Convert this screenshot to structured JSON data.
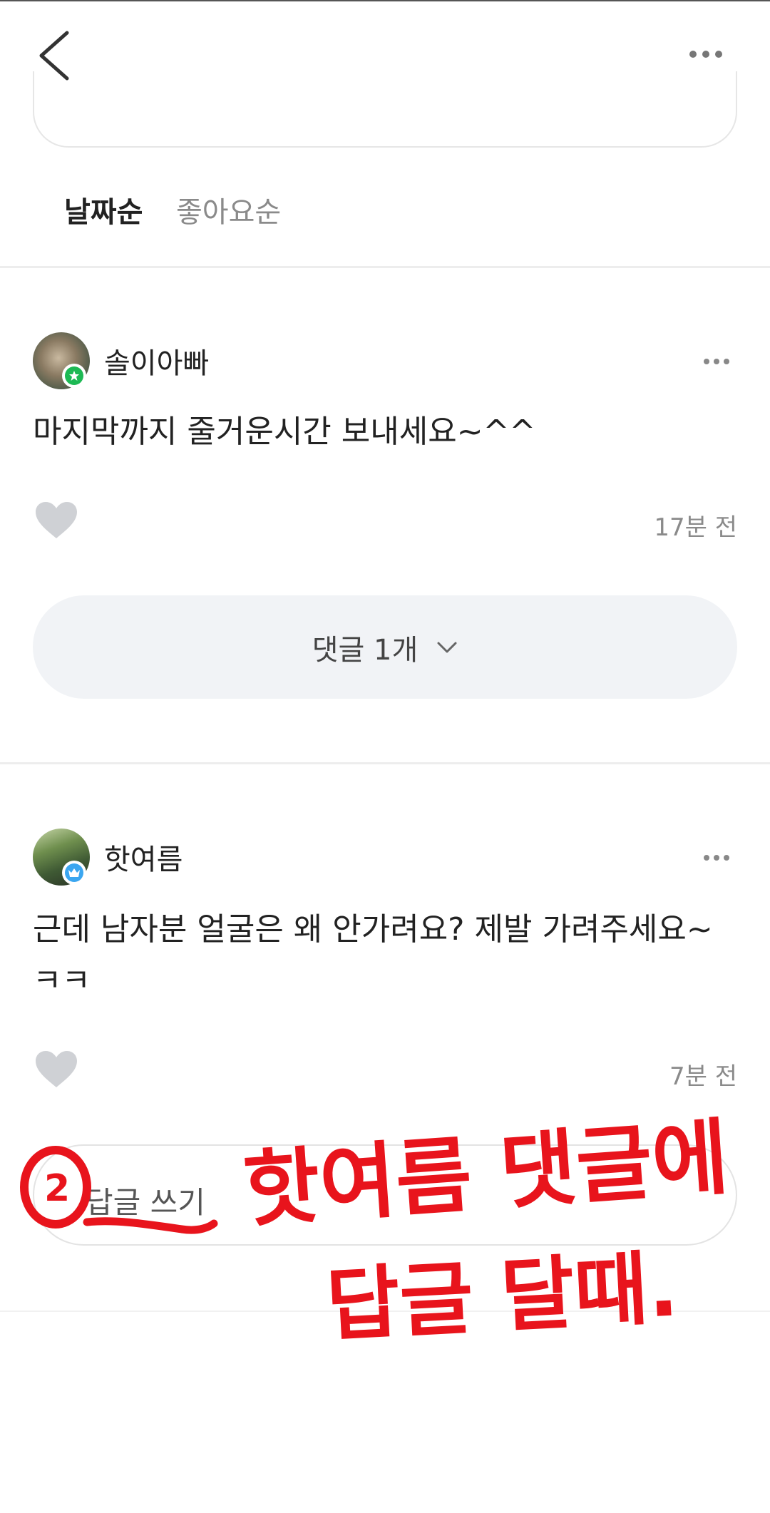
{
  "header": {
    "back_icon": "chevron-left-icon",
    "more_icon": "more-horizontal-icon"
  },
  "sort_tabs": [
    {
      "label": "날짜순",
      "active": true
    },
    {
      "label": "좋아요순",
      "active": false
    }
  ],
  "comments": [
    {
      "author": "솔이아빠",
      "text": "마지막까지 줄거운시간 보내세요~^^",
      "time": "17분 전",
      "reply_label": "댓글 1개",
      "badge_color": "#1db954",
      "badge_icon": "star-icon"
    },
    {
      "author": "핫여름",
      "text": "근데 남자분 얼굴은 왜 안가려요? 제발 가려주세요~ ㅋㅋ",
      "time": "7분 전",
      "badge_color": "#3aa6f0",
      "badge_icon": "crown-icon"
    }
  ],
  "reply_input": {
    "label": "답글 쓰기"
  },
  "annotation": {
    "number": "2",
    "line1": "핫여름 댓글에",
    "line2": "답글 달때.",
    "color": "#e8141c"
  }
}
